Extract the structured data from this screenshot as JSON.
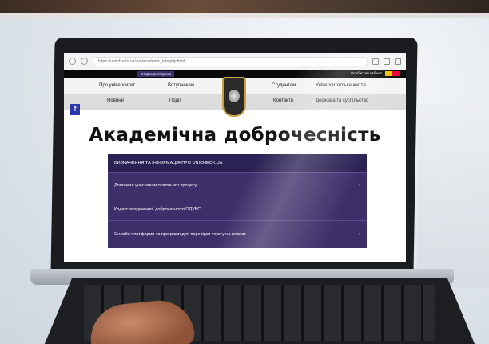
{
  "browser": {
    "url": "https://ubirch.edu.ua/zvo/academic_integrity.html"
  },
  "site": {
    "top_left": "Стартова сторінка",
    "top_right": "Особистий кабінет"
  },
  "menu": {
    "row1": [
      "Про університет",
      "Вступникам",
      "Студентам",
      "Університетське життя"
    ],
    "row2": [
      "Новини",
      "Події",
      "Контакти",
      "Держава та суспільство"
    ]
  },
  "page": {
    "title": "Академічна доброчесність"
  },
  "accordion": [
    {
      "label": "ВИЗНАЧЕННЯ ТА ІНФОРМАЦІЯ ПРО UNICHECK.UA",
      "has_chevron": false
    },
    {
      "label": "Допомога учасникам освітнього процесу",
      "has_chevron": true
    },
    {
      "label": "Кодекс академічної доброчесності ОДУВС",
      "has_chevron": false
    },
    {
      "label": "Онлайн платформи та програми для перевірки тексту на плагіат",
      "has_chevron": true
    }
  ],
  "colors": {
    "accordion_bg": "#3e2f6a",
    "accessibility_button": "#2b37a8"
  }
}
